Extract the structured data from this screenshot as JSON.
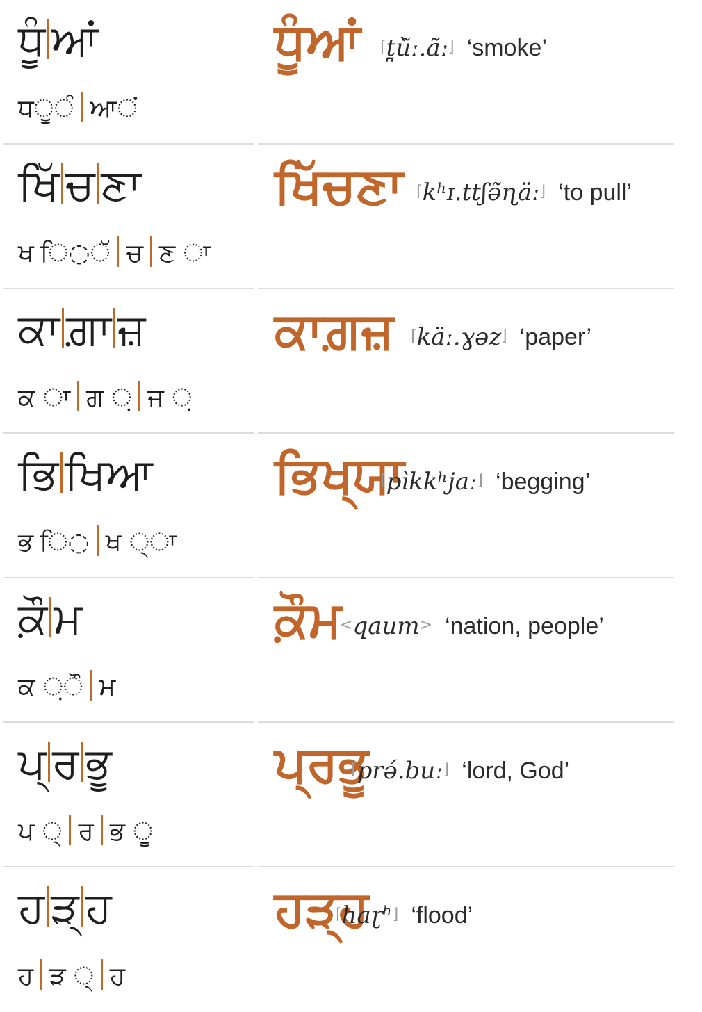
{
  "accent_color": "#c0662a",
  "rows": [
    {
      "split_segments": [
        "ਧੂੰ",
        "ਆਂ"
      ],
      "part_segments": [
        "ਧ◌ੂ◌ੰ",
        "ਆ◌ਂ"
      ],
      "word": "ਧੂੰਆਂ",
      "ipa_open": "⌈",
      "ipa": "t̪ù̃ː.ã̃ː",
      "ipa_close": "⌋",
      "meaning": "‘smoke’"
    },
    {
      "split_segments": [
        "ਖਿੱ",
        "ਚ",
        "ਣਾ"
      ],
      "part_segments": [
        "ਖ ਿ◌◌ੱ",
        "ਚ",
        "ਣ ◌ਾ"
      ],
      "word": "ਖਿੱਚਣਾ",
      "ipa_open": "⌈",
      "ipa": "kʰɪ.ttʃə̃ɳäː",
      "ipa_close": "⌋",
      "meaning": "‘to pull’"
    },
    {
      "split_segments": [
        "ਕਾ",
        "ਗ਼ਾ",
        "ਜ਼"
      ],
      "part_segments": [
        "ਕ ◌ਾ",
        "ਗ ◌਼",
        "ਜ ◌਼"
      ],
      "word": "ਕਾਗ਼ਜ਼",
      "ipa_open": "⌈",
      "ipa": "käː.ɣəz",
      "ipa_close": "⌋",
      "meaning": "‘paper’"
    },
    {
      "split_segments": [
        "ਭਿ",
        "ਖਿਆ"
      ],
      "part_segments": [
        "ਭ ਿ◌",
        "ਖ ◌੍◌ਾ"
      ],
      "word": "ਭਿਖ੍ਯਾ",
      "ipa_open": "⌈",
      "ipa": "pìkkʰjaː",
      "ipa_close": "⌋",
      "meaning": "‘begging’"
    },
    {
      "split_segments": [
        "ਕ਼ੌ",
        "ਮ"
      ],
      "part_segments": [
        "ਕ ◌਼◌ੌ",
        "ਮ"
      ],
      "word": "ਕ਼ੌਮ",
      "ipa_open": "<",
      "ipa": "qaum",
      "ipa_close": ">",
      "meaning": "‘nation, people’"
    },
    {
      "split_segments": [
        "ਪ੍",
        "ਰ",
        "ਭੂ"
      ],
      "part_segments": [
        "ਪ ◌੍",
        "ਰ",
        "ਭ ◌ੂ"
      ],
      "word": "ਪ੍ਰਭੂ",
      "ipa_open": "⌈",
      "ipa": "prə́.buː",
      "ipa_close": "⌋",
      "meaning": "‘lord, God’"
    },
    {
      "split_segments": [
        "ਹ",
        "ੜ੍",
        "ਹ"
      ],
      "part_segments": [
        "ਹ",
        "ੜ ◌੍",
        "ਹ"
      ],
      "word": "ਹੜ੍ਹ",
      "ipa_open": "⌈",
      "ipa": "haɽʰ",
      "ipa_close": "⌋",
      "meaning": "‘flood’"
    }
  ]
}
